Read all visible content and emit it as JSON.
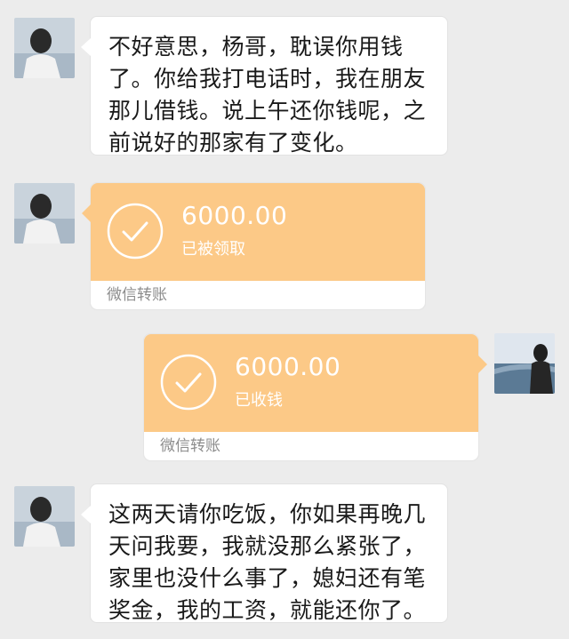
{
  "messages": [
    {
      "type": "text",
      "side": "left",
      "lines": [
        "不好意思，杨哥，耽误你用钱",
        "了。你给我打电话时，我在朋友",
        "那儿借钱。说上午还你钱呢，之",
        "前说好的那家有了变化。"
      ]
    },
    {
      "type": "transfer",
      "side": "left",
      "amount": "6000.00",
      "status": "已被领取",
      "label": "微信转账"
    },
    {
      "type": "transfer",
      "side": "right",
      "amount": "6000.00",
      "status": "已收钱",
      "label": "微信转账"
    },
    {
      "type": "text",
      "side": "left",
      "lines": [
        "这两天请你吃饭，你如果再晚几",
        "天问我要，我就没那么紧张了，",
        "家里也没什么事了，媳妇还有笔",
        "奖金，我的工资，就能还你了。"
      ]
    }
  ],
  "colors": {
    "background": "#ececec",
    "transfer": "#fcc987",
    "bubble": "#ffffff"
  }
}
